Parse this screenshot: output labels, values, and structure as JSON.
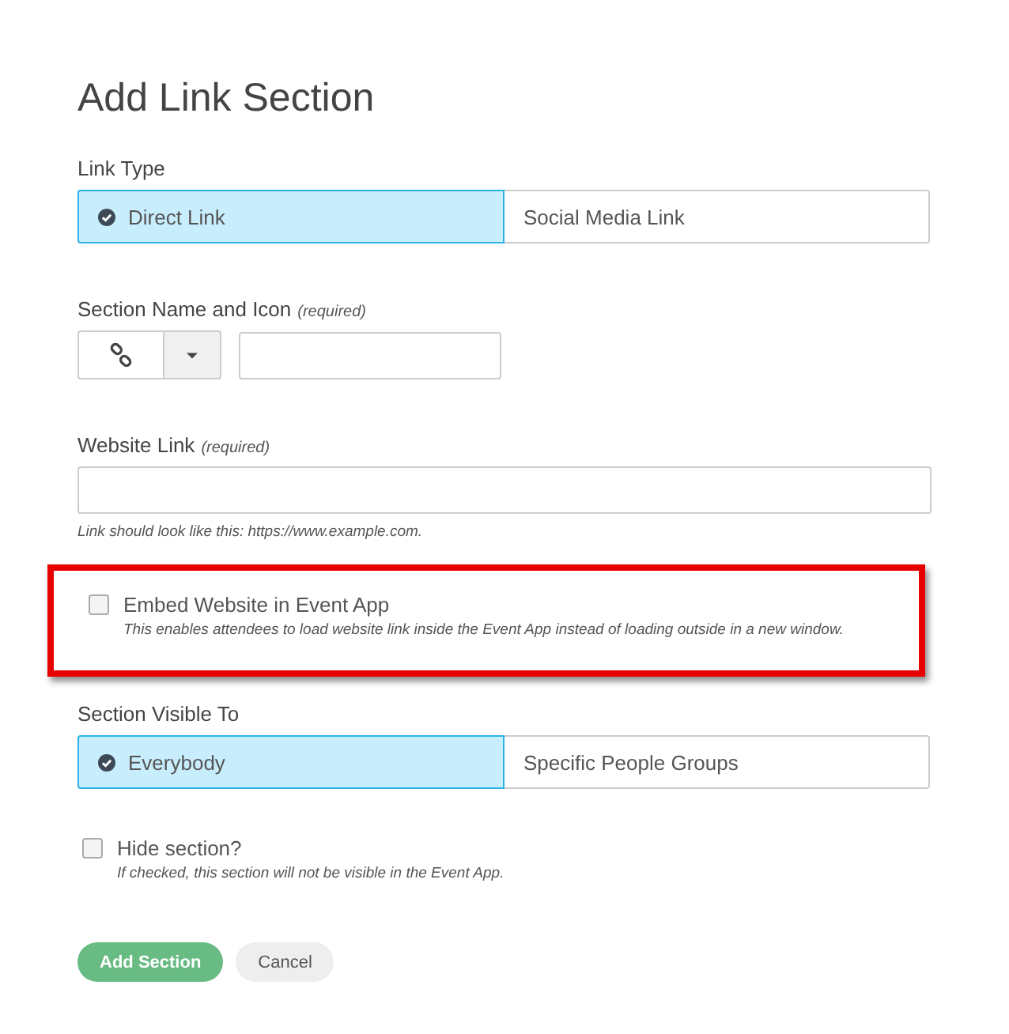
{
  "title": "Add Link Section",
  "link_type": {
    "label": "Link Type",
    "options": [
      {
        "label": "Direct Link",
        "selected": true
      },
      {
        "label": "Social Media Link",
        "selected": false
      }
    ]
  },
  "section_name": {
    "label": "Section Name and Icon",
    "required": "(required)"
  },
  "website_link": {
    "label": "Website Link",
    "required": "(required)",
    "hint": "Link should look like this: https://www.example.com."
  },
  "embed": {
    "label": "Embed Website in Event App",
    "checked": false,
    "highlighted": true,
    "hint": "This enables attendees to load website link inside the Event App instead of loading outside in a new window."
  },
  "visible_to": {
    "label": "Section Visible To",
    "options": [
      {
        "label": "Everybody",
        "selected": true
      },
      {
        "label": "Specific People Groups",
        "selected": false
      }
    ]
  },
  "hide": {
    "label": "Hide section?",
    "checked": false,
    "hint": "If checked, this section will not be visible in the Event App."
  },
  "buttons": [
    {
      "label": "Add Section",
      "kind": "primary"
    },
    {
      "label": "Cancel",
      "kind": "secondary"
    }
  ]
}
